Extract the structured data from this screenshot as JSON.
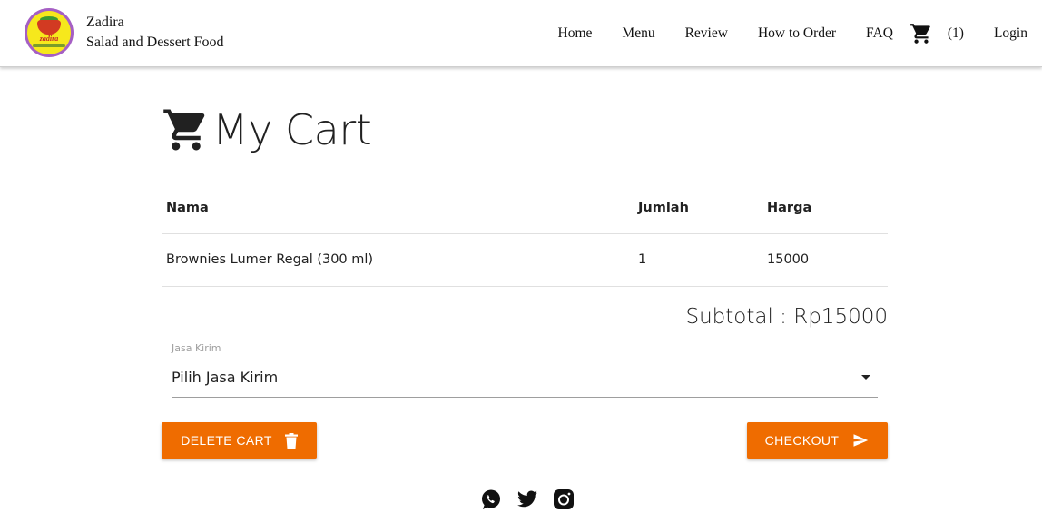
{
  "brand": {
    "logo_text": "zadira",
    "name": "Zadira",
    "tagline": "Salad and Dessert Food"
  },
  "nav": {
    "home": "Home",
    "menu": "Menu",
    "review": "Review",
    "how_to_order": "How to Order",
    "faq": "FAQ",
    "cart_icon": "shopping-cart-icon",
    "cart_count": "(1)",
    "login": "Login"
  },
  "page": {
    "title": "My Cart",
    "title_icon": "shopping-cart-icon"
  },
  "cart": {
    "columns": [
      "Nama",
      "Jumlah",
      "Harga"
    ],
    "rows": [
      {
        "name": "Brownies Lumer Regal (300 ml)",
        "qty": "1",
        "price": "15000"
      }
    ],
    "subtotal": "Subtotal : Rp15000"
  },
  "shipping": {
    "label": "Jasa Kirim",
    "selected": "Pilih Jasa Kirim"
  },
  "buttons": {
    "delete": "DELETE CART",
    "delete_icon": "trash-icon",
    "checkout": "CHECKOUT",
    "checkout_icon": "send-icon"
  },
  "footer": {
    "icons": [
      "whatsapp-icon",
      "twitter-icon",
      "instagram-icon"
    ]
  },
  "colors": {
    "accent": "#ef6c00",
    "logo_ring": "#a55fc4",
    "logo_fill": "#f6e81c"
  }
}
